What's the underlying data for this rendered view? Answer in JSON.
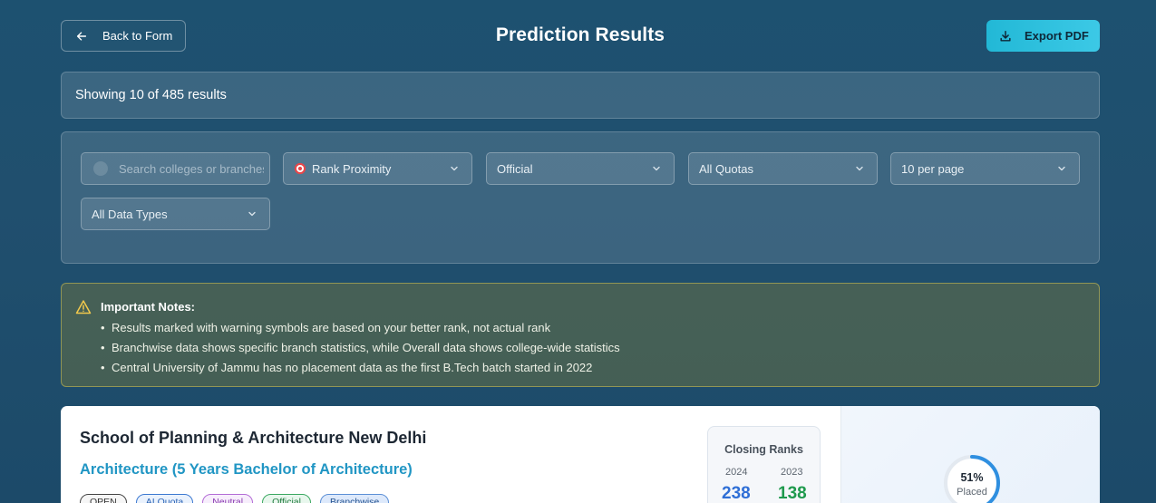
{
  "header": {
    "back_label": "Back to Form",
    "title": "Prediction Results",
    "export_label": "Export PDF"
  },
  "results": {
    "summary": "Showing 10 of 485 results"
  },
  "filters": {
    "search_placeholder": "Search colleges or branches...",
    "sort_value": "Rank Proximity",
    "source_value": "Official",
    "quota_value": "All Quotas",
    "page_size_value": "10 per page",
    "data_type_value": "All Data Types"
  },
  "notes": {
    "title": "Important Notes:",
    "items": [
      "Results marked with warning symbols are based on your better rank, not actual rank",
      "Branchwise data shows specific branch statistics, while Overall data shows college-wide statistics",
      "Central University of Jammu has no placement data as the first B.Tech batch started in 2022"
    ]
  },
  "cards": [
    {
      "college": "School of Planning & Architecture New Delhi",
      "branch": "Architecture (5 Years Bachelor of Architecture)",
      "tags": [
        "OPEN",
        "AI Quota",
        "Neutral",
        "Official",
        "Branchwise"
      ],
      "closing_ranks": {
        "title": "Closing Ranks",
        "year_1": "2024",
        "rank_1": "238",
        "year_2": "2023",
        "rank_2": "138"
      },
      "placement": {
        "percent_label": "51%",
        "percent_value": 51,
        "label": "Placed"
      }
    }
  ],
  "colors": {
    "accent": "#22b8d6",
    "rank_2024": "#2f6fd6",
    "rank_2023": "#1f9a4d",
    "branch": "#2196c4"
  },
  "icons": {
    "back": "arrow-left-icon",
    "export": "download-icon",
    "sort": "target-icon",
    "notes": "warning-icon"
  }
}
